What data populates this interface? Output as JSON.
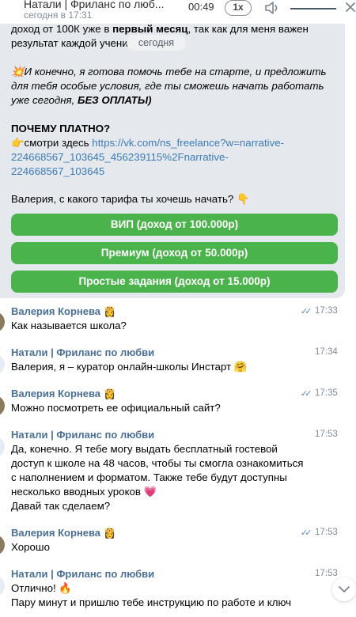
{
  "player": {
    "title": "Натали | Фриланс по люб...",
    "subtitle": "сегодня в 17:31",
    "time": "00:49",
    "speed": "1x",
    "volume_icon": "speaker-icon",
    "close_icon": "close-icon"
  },
  "date_divider": "сегодня",
  "bot_message": {
    "line1_pre": "доход от 100К уже в ",
    "line1_bold": "первый месяц",
    "line1_post": ", так как для меня важен",
    "line2": "результат каждой учени",
    "p2_l1": "💥И конечно,  я готова помочь тебе на старте, и предложить",
    "p2_l2": "для тебя особые условия, где ты сможешь начать работать",
    "p2_l3_pre": "уже сегодня,  ",
    "p2_l3_bold": "БЕЗ ОПЛАТЫ)",
    "why_title": "ПОЧЕМУ ПЛАТНО?",
    "see_here": "👉смотри здесь ",
    "link1": "https://vk.com/ns_freelance?w=narrative-",
    "link2": "224668567_103645_456239115%2Fnarrative-",
    "link3": "224668567_103645",
    "question": "Валерия, с какого тарифа ты хочешь начать? 👇"
  },
  "buttons": [
    {
      "label": "ВИП (доход от 100.000р)"
    },
    {
      "label": "Премиум (доход от 50.000р)"
    },
    {
      "label": "Простые задания (доход от 15.000р)"
    }
  ],
  "colors": {
    "button_green": "#4bb34b",
    "bubble_bg": "#e5e8ec",
    "sender_blue": "#4a6f96",
    "link_blue": "#3c7cb8"
  },
  "messages": [
    {
      "sender": "Валерия Корнева",
      "crown": "👸",
      "time": "17:33",
      "read": true,
      "lines": [
        "Как называется школа?"
      ]
    },
    {
      "sender": "Натали | Фриланс по любви",
      "crown": "",
      "time": "17:34",
      "read": false,
      "lines": [
        "Валерия, я – куратор онлайн-школы Инстарт 🤗"
      ]
    },
    {
      "sender": "Валерия Корнева",
      "crown": "👸",
      "time": "17:35",
      "read": true,
      "lines": [
        "Можно посмотреть ее официальный сайт?"
      ]
    },
    {
      "sender": "Натали | Фриланс по любви",
      "crown": "",
      "time": "17:53",
      "read": false,
      "lines": [
        "Да, конечно. Я тебе могу выдать бесплатный гостевой",
        "доступ к школе на 48 часов, чтобы ты смогла ознакомиться",
        "с наполнением и форматом. Также тебе будут доступны",
        "несколько вводных уроков 💗",
        "Давай так сделаем?"
      ]
    },
    {
      "sender": "Валерия Корнева",
      "crown": "👸",
      "time": "17:53",
      "read": true,
      "lines": [
        "Хорошо"
      ]
    },
    {
      "sender": "Натали | Фриланс по любви",
      "crown": "",
      "time": "17:53",
      "read": false,
      "lines": [
        "Отлично! 🔥",
        "Пару минут и пришлю тебе инструкцию по работе и ключ"
      ]
    }
  ]
}
